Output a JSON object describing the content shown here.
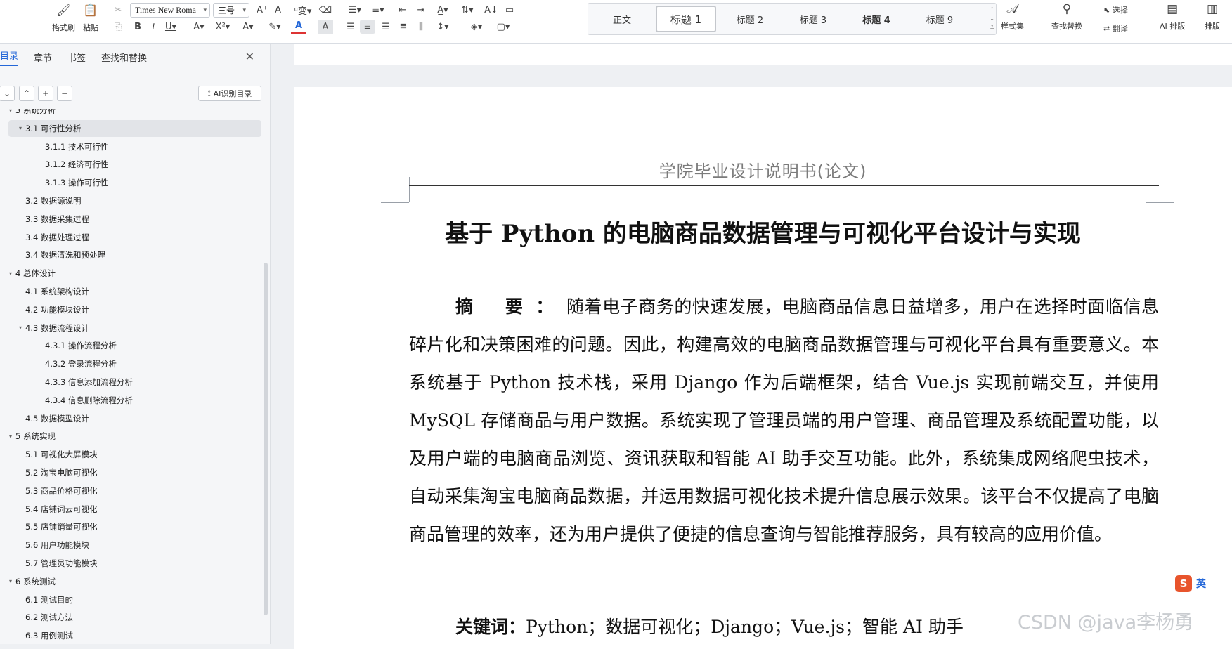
{
  "ribbon": {
    "format_painter": "格式刷",
    "paste": "粘贴",
    "font_name": "Times New Roma",
    "font_size": "三号",
    "styles": [
      "正文",
      "标题 1",
      "标题 2",
      "标题 3",
      "标题 4",
      "标题 9"
    ],
    "style_set": "样式集",
    "find_replace": "查找替换",
    "select": "选择",
    "translate": "翻译",
    "ai_layout": "AI 排版",
    "layout": "排版"
  },
  "panel": {
    "tabs": [
      "目录",
      "章节",
      "书签",
      "查找和替换"
    ],
    "ai_toc_button": "AI识别目录",
    "toc": [
      {
        "level": 1,
        "text": "3 系统分析",
        "caret": "▾"
      },
      {
        "level": 2,
        "text": "3.1  可行性分析",
        "caret": "▾"
      },
      {
        "level": 3,
        "text": "3.1.1  技术可行性",
        "caret": ""
      },
      {
        "level": 3,
        "text": "3.1.2  经济可行性",
        "caret": ""
      },
      {
        "level": 3,
        "text": "3.1.3  操作可行性",
        "caret": ""
      },
      {
        "level": 2,
        "text": "3.2 数据源说明",
        "caret": ""
      },
      {
        "level": 2,
        "text": "3.3 数据采集过程",
        "caret": ""
      },
      {
        "level": 2,
        "text": "3.4 数据处理过程",
        "caret": ""
      },
      {
        "level": 2,
        "text": "3.4 数据清洗和预处理",
        "caret": ""
      },
      {
        "level": 1,
        "text": "4 总体设计",
        "caret": "▾"
      },
      {
        "level": 2,
        "text": "4.1 系统架构设计",
        "caret": ""
      },
      {
        "level": 2,
        "text": "4.2 功能模块设计",
        "caret": ""
      },
      {
        "level": 2,
        "text": "4.3 数据流程设计",
        "caret": "▾"
      },
      {
        "level": 3,
        "text": "4.3.1 操作流程分析",
        "caret": ""
      },
      {
        "level": 3,
        "text": "4.3.2 登录流程分析",
        "caret": ""
      },
      {
        "level": 3,
        "text": "4.3.3 信息添加流程分析",
        "caret": ""
      },
      {
        "level": 3,
        "text": "4.3.4 信息删除流程分析",
        "caret": ""
      },
      {
        "level": 2,
        "text": "4.5  数据模型设计",
        "caret": ""
      },
      {
        "level": 1,
        "text": "5 系统实现",
        "caret": "▾"
      },
      {
        "level": 2,
        "text": "5.1  可视化大屏模块",
        "caret": ""
      },
      {
        "level": 2,
        "text": "5.2  淘宝电脑可视化",
        "caret": ""
      },
      {
        "level": 2,
        "text": "5.3  商品价格可视化",
        "caret": ""
      },
      {
        "level": 2,
        "text": "5.4  店铺词云可视化",
        "caret": ""
      },
      {
        "level": 2,
        "text": "5.5  店铺销量可视化",
        "caret": ""
      },
      {
        "level": 2,
        "text": "5.6  用户功能模块",
        "caret": ""
      },
      {
        "level": 2,
        "text": "5.7  管理员功能模块",
        "caret": ""
      },
      {
        "level": 1,
        "text": "6 系统测试",
        "caret": "▾"
      },
      {
        "level": 2,
        "text": "6.1  测试目的",
        "caret": ""
      },
      {
        "level": 2,
        "text": "6.2  测试方法",
        "caret": ""
      },
      {
        "level": 2,
        "text": "6.3  用例测试",
        "caret": ""
      }
    ],
    "selected_index": 1
  },
  "document": {
    "header": "学院毕业设计说明书(论文)",
    "title": "基于 Python 的电脑商品数据管理与可视化平台设计与实现",
    "abstract_label": "摘  要：",
    "abstract_text": "随着电子商务的快速发展，电脑商品信息日益增多，用户在选择时面临信息碎片化和决策困难的问题。因此，构建高效的电脑商品数据管理与可视化平台具有重要意义。本系统基于 Python 技术栈，采用 Django 作为后端框架，结合 Vue.js 实现前端交互，并使用 MySQL 存储商品与用户数据。系统实现了管理员端的用户管理、商品管理及系统配置功能，以及用户端的电脑商品浏览、资讯获取和智能 AI 助手交互功能。此外，系统集成网络爬虫技术，自动采集淘宝电脑商品数据，并运用数据可视化技术提升信息展示效果。该平台不仅提高了电脑商品管理的效率，还为用户提供了便捷的信息查询与智能推荐服务，具有较高的应用价值。",
    "keywords_label": "关键词：",
    "keywords_text": "Python；数据可视化；Django；Vue.js；智能 AI 助手"
  },
  "watermark": "CSDN @java李杨勇",
  "ime": {
    "logo": "S",
    "mode": "英"
  },
  "colors": {
    "accent": "#2467d8",
    "ime": "#e8542c"
  }
}
